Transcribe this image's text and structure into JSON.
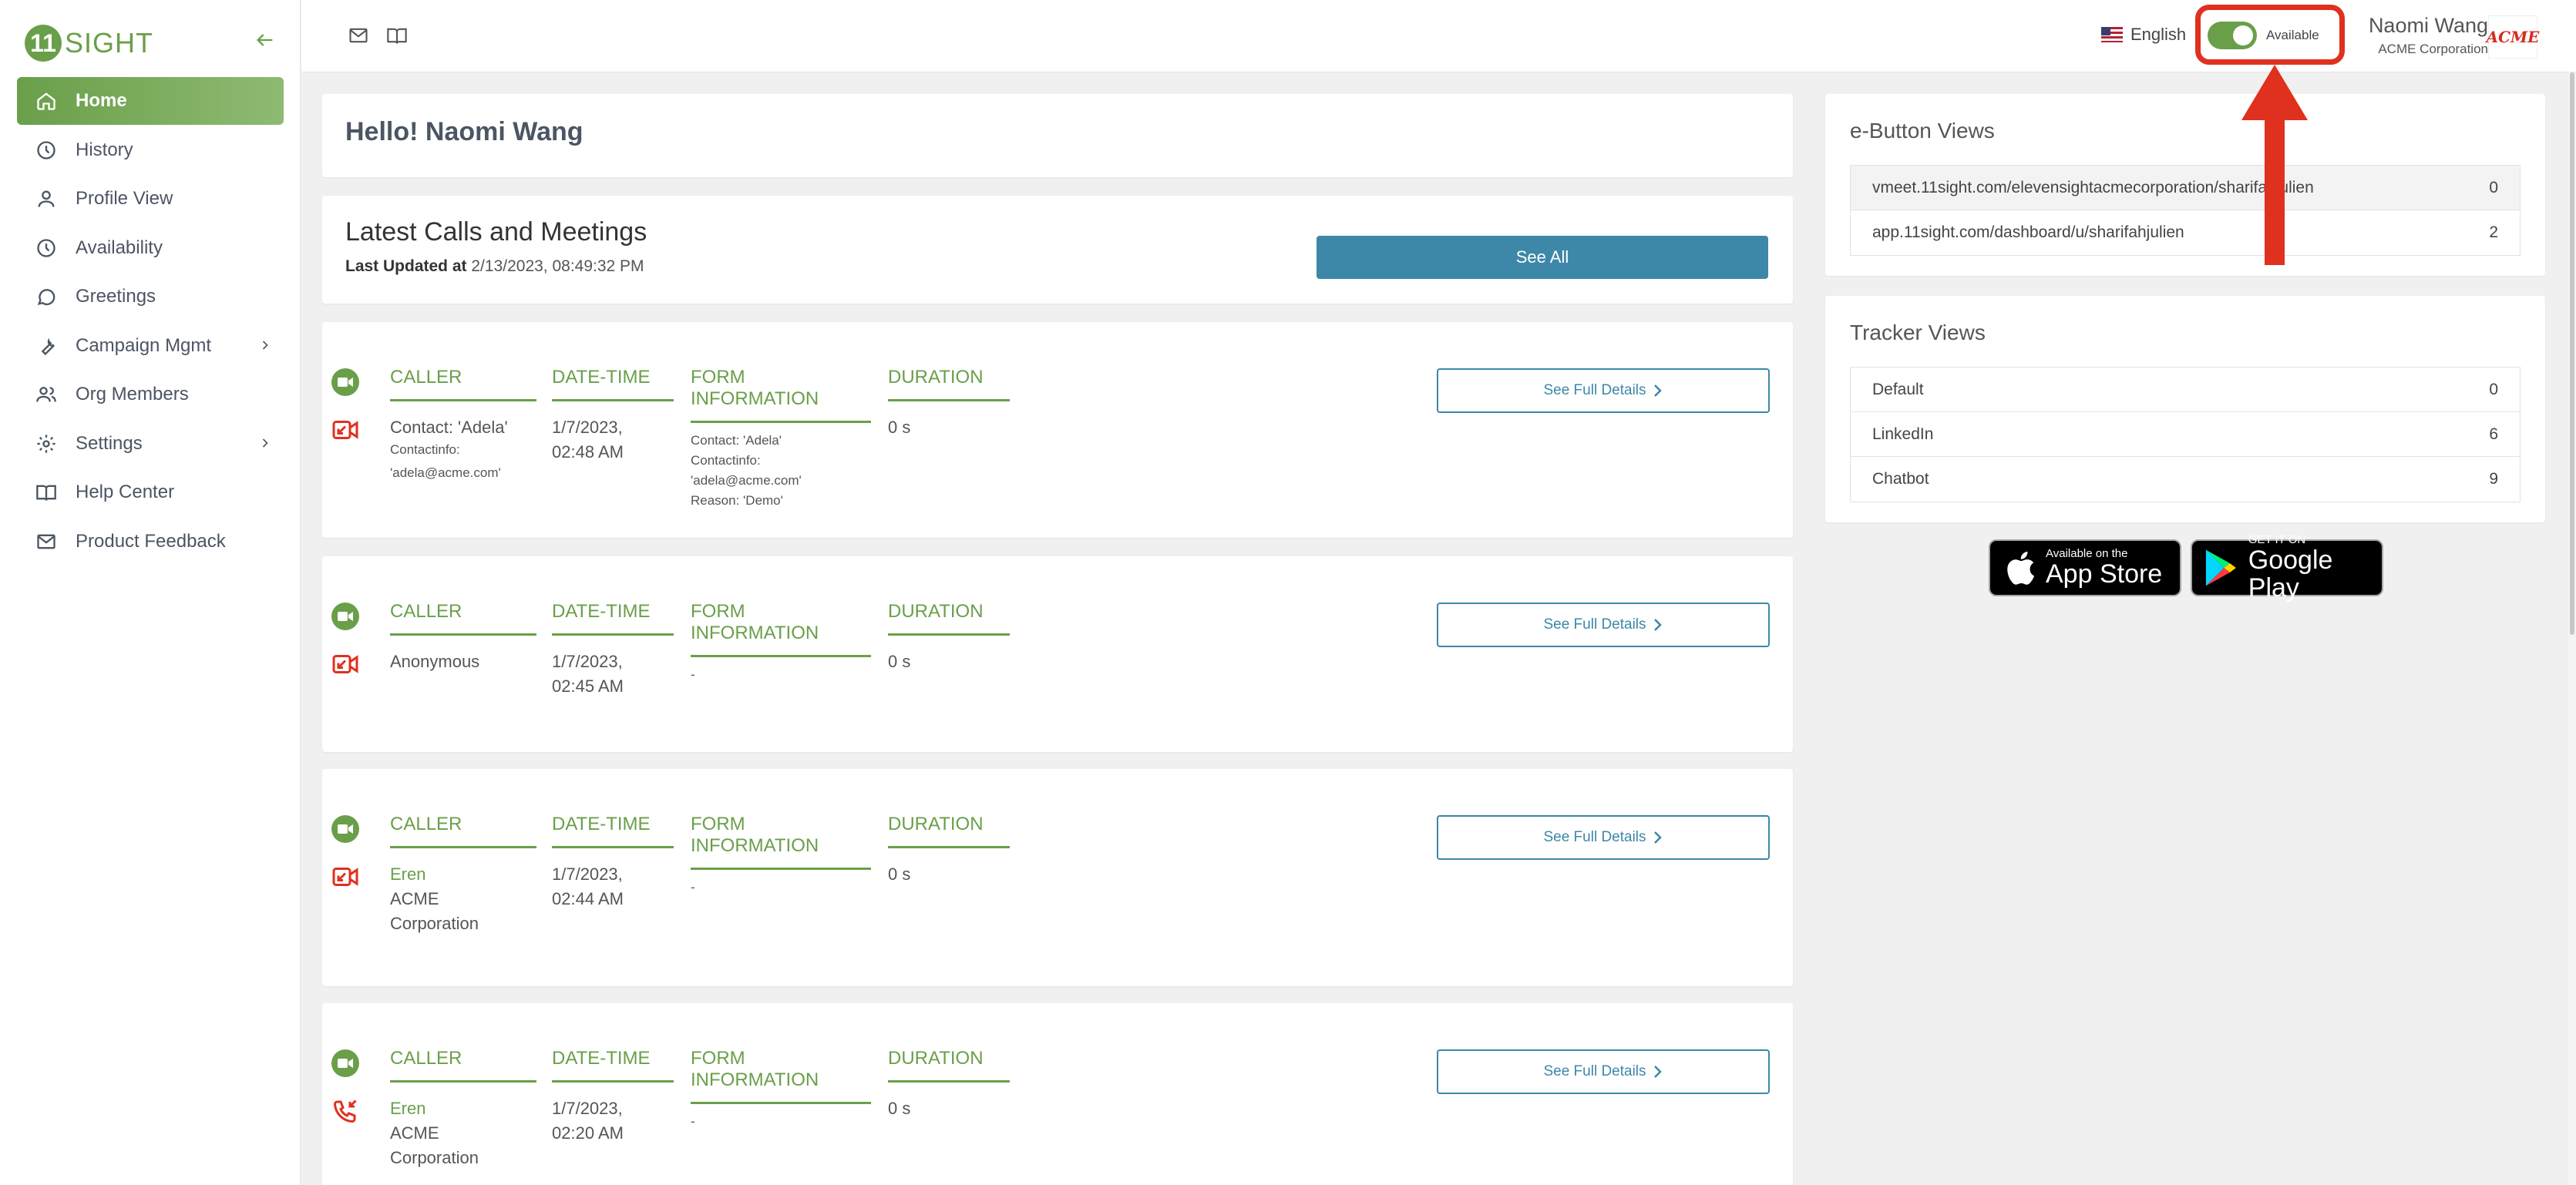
{
  "brand": {
    "logo_mark": "11",
    "logo_text": "SIGHT"
  },
  "sidebar": {
    "items": [
      {
        "label": "Home",
        "icon": "home-icon"
      },
      {
        "label": "History",
        "icon": "clock-icon"
      },
      {
        "label": "Profile View",
        "icon": "person-icon"
      },
      {
        "label": "Availability",
        "icon": "clock-icon"
      },
      {
        "label": "Greetings",
        "icon": "chat-bubble-icon"
      },
      {
        "label": "Campaign Mgmt",
        "icon": "wrench-icon"
      },
      {
        "label": "Org Members",
        "icon": "people-icon"
      },
      {
        "label": "Settings",
        "icon": "gear-icon"
      },
      {
        "label": "Help Center",
        "icon": "book-icon"
      },
      {
        "label": "Product Feedback",
        "icon": "mail-icon"
      }
    ]
  },
  "topbar": {
    "language": "English",
    "status_label": "Available",
    "user_name": "Naomi Wang",
    "user_company": "ACME Corporation",
    "company_logo_text": "ACME"
  },
  "main": {
    "greeting": "Hello! Naomi Wang",
    "latest": {
      "title": "Latest Calls and Meetings",
      "updated_label": "Last Updated at",
      "updated_value": "2/13/2023, 08:49:32 PM",
      "see_all": "See All"
    },
    "columns": {
      "caller": "CALLER",
      "datetime": "DATE-TIME",
      "form": "FORM INFORMATION",
      "duration": "DURATION"
    },
    "detail_label": "See Full Details",
    "calls": [
      {
        "caller_lines": [
          "Contact: 'Adela'"
        ],
        "caller_small": [
          "Contactinfo:",
          "'adela@acme.com'"
        ],
        "datetime": [
          "1/7/2023,",
          "02:48 AM"
        ],
        "form": [
          "Contact: 'Adela'",
          "Contactinfo:",
          "'adela@acme.com'",
          "Reason: 'Demo'"
        ],
        "duration": "0 s"
      },
      {
        "caller_lines": [
          "Anonymous"
        ],
        "datetime": [
          "1/7/2023,",
          "02:45 AM"
        ],
        "form": [
          "-"
        ],
        "duration": "0 s"
      },
      {
        "caller_name": "Eren",
        "caller_lines": [
          "ACME",
          "Corporation"
        ],
        "datetime": [
          "1/7/2023,",
          "02:44 AM"
        ],
        "form": [
          "-"
        ],
        "duration": "0 s"
      },
      {
        "caller_name": "Eren",
        "caller_lines": [
          "ACME",
          "Corporation"
        ],
        "datetime": [
          "1/7/2023,",
          "02:20 AM"
        ],
        "form": [
          "-"
        ],
        "duration": "0 s"
      }
    ]
  },
  "ebutton": {
    "title": "e-Button Views",
    "rows": [
      {
        "label": "vmeet.11sight.com/elevensightacmecorporation/sharifahjulien",
        "value": "0"
      },
      {
        "label": "app.11sight.com/dashboard/u/sharifahjulien",
        "value": "2"
      }
    ]
  },
  "tracker": {
    "title": "Tracker Views",
    "rows": [
      {
        "label": "Default",
        "value": "0"
      },
      {
        "label": "LinkedIn",
        "value": "6"
      },
      {
        "label": "Chatbot",
        "value": "9"
      }
    ]
  },
  "stores": {
    "apple_small": "Available on the",
    "apple_big": "App Store",
    "google_small": "GET IT ON",
    "google_big": "Google Play"
  },
  "colors": {
    "brand_green": "#6a9f4a",
    "button_blue": "#3d87a8",
    "annotation_red": "#e0301e"
  }
}
